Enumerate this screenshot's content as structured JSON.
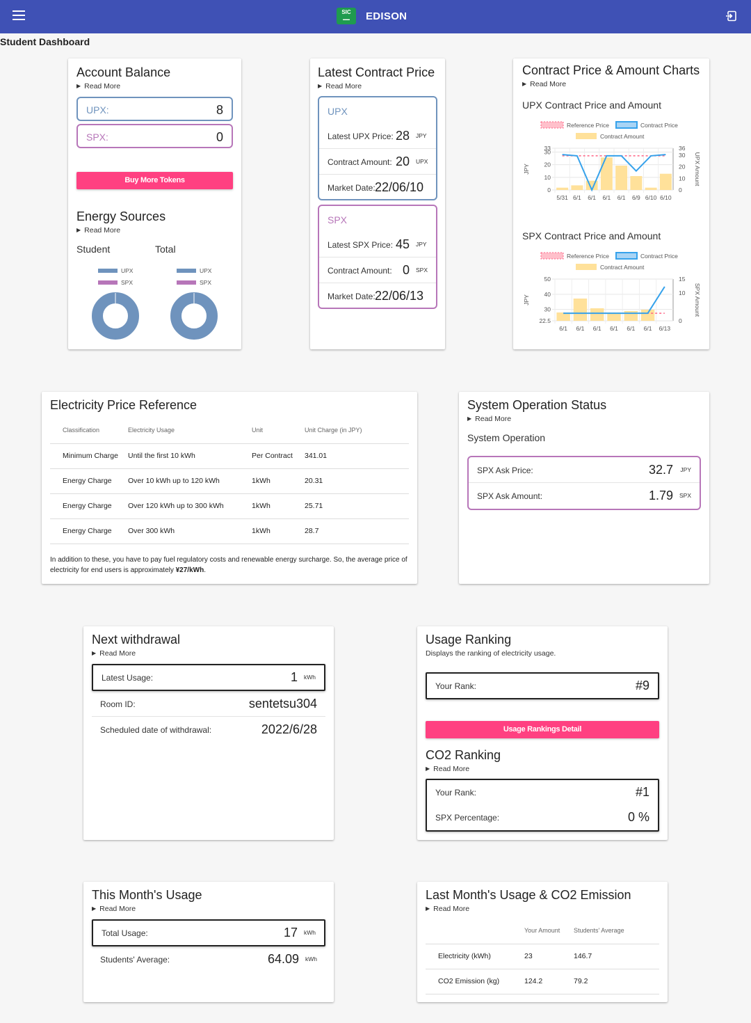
{
  "app": {
    "name": "EDISON",
    "logo_text": "SIC"
  },
  "page": {
    "title": "Student Dashboard"
  },
  "account": {
    "title": "Account Balance",
    "read_more": "Read More",
    "upx_label": "UPX:",
    "upx_value": "8",
    "spx_label": "SPX:",
    "spx_value": "0",
    "buy_button": "Buy More Tokens"
  },
  "energy": {
    "title": "Energy Sources",
    "read_more": "Read More",
    "student_label": "Student",
    "total_label": "Total",
    "legend_upx": "UPX",
    "legend_spx": "SPX",
    "student_upx_share": 1,
    "total_upx_share": 1
  },
  "latest": {
    "title": "Latest Contract Price",
    "read_more": "Read More",
    "upx": {
      "name": "UPX",
      "price_label": "Latest UPX Price:",
      "price_value": "28",
      "price_unit": "JPY",
      "amount_label": "Contract Amount:",
      "amount_value": "20",
      "amount_unit": "UPX",
      "date_label": "Market Date:",
      "date_value": "22/06/10"
    },
    "spx": {
      "name": "SPX",
      "price_label": "Latest SPX Price:",
      "price_value": "45",
      "price_unit": "JPY",
      "amount_label": "Contract Amount:",
      "amount_value": "0",
      "amount_unit": "SPX",
      "date_label": "Market Date:",
      "date_value": "22/06/13"
    }
  },
  "charts": {
    "title": "Contract Price & Amount Charts",
    "read_more": "Read More",
    "upx_title": "UPX Contract Price and Amount",
    "spx_title": "SPX Contract Price and Amount",
    "legend_ref": "Reference Price",
    "legend_price": "Contract Price",
    "legend_amount": "Contract Amount"
  },
  "chart_data": [
    {
      "type": "bar",
      "title": "UPX Contract Price and Amount",
      "categories": [
        "5/31",
        "6/1",
        "6/1",
        "6/1",
        "6/1",
        "6/9",
        "6/10",
        "6/10"
      ],
      "series": [
        {
          "name": "Contract Amount",
          "axis": "right",
          "values": [
            2,
            4,
            8,
            28,
            21,
            12,
            2,
            14
          ]
        },
        {
          "name": "Contract Price",
          "axis": "left",
          "type": "line",
          "values": [
            28,
            27,
            0,
            27,
            27,
            15,
            27,
            28
          ]
        },
        {
          "name": "Reference Price",
          "axis": "left",
          "type": "line",
          "values": [
            27,
            27,
            27,
            27,
            27,
            27,
            27,
            27
          ]
        }
      ],
      "ylabel": "JPY",
      "y2label": "UPX Amount",
      "ylim": [
        0,
        33
      ],
      "y2lim": [
        0,
        36
      ],
      "yticks": [
        "0",
        "10",
        "20",
        "30",
        "33"
      ],
      "y2ticks": [
        "0",
        "10",
        "20",
        "30",
        "36"
      ]
    },
    {
      "type": "bar",
      "title": "SPX Contract Price and Amount",
      "categories": [
        "6/1",
        "6/1",
        "6/1",
        "6/1",
        "6/1",
        "6/1",
        "6/13"
      ],
      "series": [
        {
          "name": "Contract Amount",
          "axis": "right",
          "values": [
            3,
            8,
            4.5,
            3,
            3.5,
            4,
            0
          ]
        },
        {
          "name": "Contract Price",
          "axis": "left",
          "type": "line",
          "values": [
            27.5,
            27.5,
            27.5,
            27.5,
            27.5,
            27.5,
            45
          ]
        },
        {
          "name": "Reference Price",
          "axis": "left",
          "type": "line",
          "values": [
            27.5,
            27.5,
            27.5,
            27.5,
            27.5,
            27.5,
            27.5
          ]
        }
      ],
      "ylabel": "JPY",
      "y2label": "SPX Amount",
      "ylim": [
        22.5,
        50
      ],
      "y2lim": [
        0,
        15
      ],
      "yticks": [
        "22.5",
        "30",
        "40",
        "50"
      ],
      "y2ticks": [
        "0",
        "10",
        "15"
      ]
    }
  ],
  "elec": {
    "title": "Electricity Price Reference",
    "headers": [
      "Classification",
      "Electricity Usage",
      "Unit",
      "Unit Charge (in JPY)"
    ],
    "rows": [
      [
        "Minimum Charge",
        "Until the first 10 kWh",
        "Per Contract",
        "341.01"
      ],
      [
        "Energy Charge",
        "Over 10 kWh up to 120 kWh",
        "1kWh",
        "20.31"
      ],
      [
        "Energy Charge",
        "Over 120 kWh up to 300 kWh",
        "1kWh",
        "25.71"
      ],
      [
        "Energy Charge",
        "Over 300 kWh",
        "1kWh",
        "28.7"
      ]
    ],
    "note": "In addition to these, you have to pay fuel regulatory costs and renewable energy surcharge. So, the average price of electricity for end users is approximately ",
    "note_bold": "¥27/kWh",
    "note_end": "."
  },
  "sysop": {
    "title": "System Operation Status",
    "read_more": "Read More",
    "subtitle": "System Operation",
    "ask_price_label": "SPX Ask Price:",
    "ask_price_value": "32.7",
    "ask_price_unit": "JPY",
    "ask_amount_label": "SPX Ask Amount:",
    "ask_amount_value": "1.79",
    "ask_amount_unit": "SPX"
  },
  "withdrawal": {
    "title": "Next withdrawal",
    "read_more": "Read More",
    "latest_label": "Latest Usage:",
    "latest_value": "1",
    "latest_unit": "kWh",
    "room_label": "Room ID:",
    "room_value": "sentetsu304",
    "date_label": "Scheduled date of withdrawal:",
    "date_value": "2022/6/28"
  },
  "ranking": {
    "title": "Usage Ranking",
    "subtitle": "Displays the ranking of electricity usage.",
    "rank_label": "Your Rank:",
    "rank_value": "#9",
    "detail_button": "Usage Rankings Detail"
  },
  "co2": {
    "title": "CO2 Ranking",
    "read_more": "Read More",
    "rank_label": "Your Rank:",
    "rank_value": "#1",
    "pct_label": "SPX Percentage:",
    "pct_value": "0 %"
  },
  "month": {
    "title": "This Month's Usage",
    "read_more": "Read More",
    "total_label": "Total Usage:",
    "total_value": "17",
    "total_unit": "kWh",
    "avg_label": "Students' Average:",
    "avg_value": "64.09",
    "avg_unit": "kWh"
  },
  "last": {
    "title": "Last Month's Usage & CO2 Emission",
    "read_more": "Read More",
    "headers": [
      "",
      "Your Amount",
      "Students' Average"
    ],
    "rows": [
      [
        "Electricity (kWh)",
        "23",
        "146.7"
      ],
      [
        "CO2 Emission (kg)",
        "124.2",
        "79.2"
      ]
    ]
  }
}
